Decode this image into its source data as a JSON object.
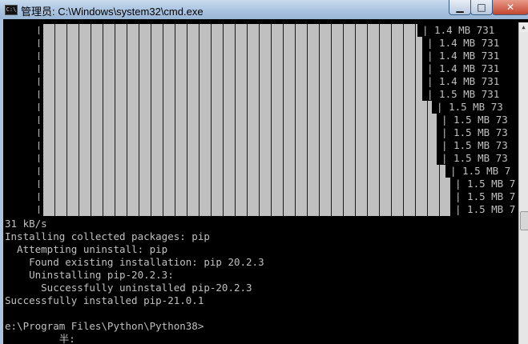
{
  "window": {
    "title": "管理员: C:\\Windows\\system32\\cmd.exe",
    "icon_name": "cmd-icon",
    "minimize_glyph": "▁",
    "maximize_glyph": "□",
    "close_glyph": "✕"
  },
  "progress": {
    "bar_color": "#c0c0c0",
    "rows": [
      {
        "size": "1.4 MB 731",
        "completion": 0.91
      },
      {
        "size": "1.4 MB 731",
        "completion": 0.92
      },
      {
        "size": "1.4 MB 731",
        "completion": 0.92
      },
      {
        "size": "1.4 MB 731",
        "completion": 0.92
      },
      {
        "size": "1.4 MB 731",
        "completion": 0.92
      },
      {
        "size": "1.5 MB 731",
        "completion": 0.92
      },
      {
        "size": "1.5 MB 73",
        "completion": 0.94
      },
      {
        "size": "1.5 MB 73",
        "completion": 0.95
      },
      {
        "size": "1.5 MB 73",
        "completion": 0.95
      },
      {
        "size": "1.5 MB 73",
        "completion": 0.95
      },
      {
        "size": "1.5 MB 73",
        "completion": 0.95
      },
      {
        "size": "1.5 MB 7",
        "completion": 0.97
      },
      {
        "size": "1.5 MB 7",
        "completion": 0.98
      },
      {
        "size": "1.5 MB 7",
        "completion": 0.98
      },
      {
        "size": "1.5 MB 7",
        "completion": 0.98
      }
    ]
  },
  "output": {
    "lines": [
      "31 kB/s",
      "Installing collected packages: pip",
      "  Attempting uninstall: pip",
      "    Found existing installation: pip 20.2.3",
      "    Uninstalling pip-20.2.3:",
      "      Successfully uninstalled pip-20.2.3",
      "Successfully installed pip-21.0.1",
      "",
      "e:\\Program Files\\Python\\Python38>",
      "         半:"
    ]
  }
}
